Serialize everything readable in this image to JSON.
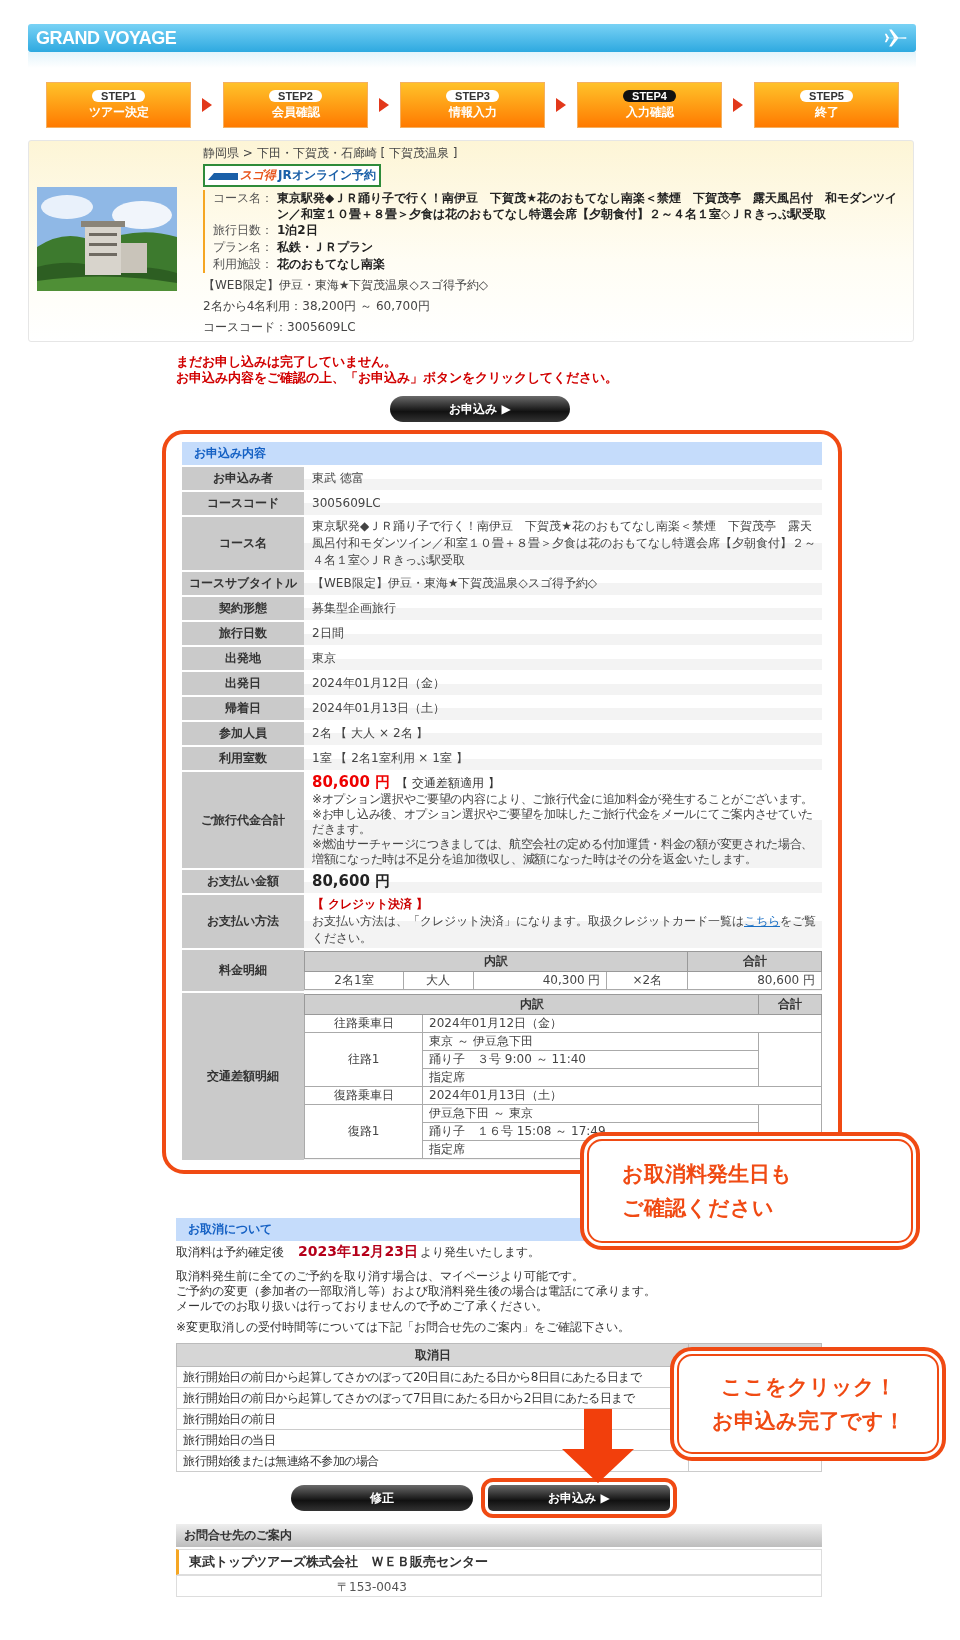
{
  "header": {
    "brand": "GRAND VOYAGE"
  },
  "steps": [
    {
      "badge": "STEP1",
      "label": "ツアー決定",
      "selected": false
    },
    {
      "badge": "STEP2",
      "label": "会員確認",
      "selected": false
    },
    {
      "badge": "STEP3",
      "label": "情報入力",
      "selected": false
    },
    {
      "badge": "STEP4",
      "label": "入力確認",
      "selected": true
    },
    {
      "badge": "STEP5",
      "label": "終了",
      "selected": false
    }
  ],
  "course": {
    "breadcrumb": "静岡県 > 下田・下賀茂・石廊崎 [ 下賀茂温泉 ]",
    "badge": {
      "brand": "スゴ得",
      "label": "JRオンライン予約"
    },
    "details": [
      {
        "label": "コース名：",
        "value": "東京駅発◆ＪＲ踊り子で行く！南伊豆　下賀茂★花のおもてなし南楽＜禁煙　下賀茂亭　露天風呂付　和モダンツイン／和室１０畳＋８畳＞夕食は花のおもてなし特選会席【夕朝食付】２～４名１室◇ＪＲきっぷ駅受取"
      },
      {
        "label": "旅行日数：",
        "value": "1泊2日"
      },
      {
        "label": "プラン名：",
        "value": "私鉄・ＪＲプラン"
      },
      {
        "label": "利用施設：",
        "value": "花のおもてなし南楽"
      }
    ],
    "subtitle": "【WEB限定】伊豆・東海★下賀茂温泉◇スゴ得予約◇",
    "price_range": "2名から4名利用：38,200円 ～ 60,700円",
    "code": "コースコード：3005609LC"
  },
  "notice": [
    "まだお申し込みは完了していません。",
    "お申込み内容をご確認の上、「お申込み」ボタンをクリックしてください。"
  ],
  "top_button": "お申込み ▶",
  "form": {
    "title": "お申込み内容",
    "rows": [
      {
        "kind": "text",
        "label": "お申込み者",
        "value": "東武 徳富"
      },
      {
        "kind": "text",
        "label": "コースコード",
        "value": "3005609LC"
      },
      {
        "kind": "text",
        "label": "コース名",
        "value": "東京駅発◆ＪＲ踊り子で行く！南伊豆　下賀茂★花のおもてなし南楽＜禁煙　下賀茂亭　露天風呂付和モダンツイン／和室１０畳＋８畳＞夕食は花のおもてなし特選会席【夕朝食付】２～４名１室◇ＪＲきっぷ駅受取"
      },
      {
        "kind": "text",
        "label": "コースサブタイトル",
        "value": "【WEB限定】伊豆・東海★下賀茂温泉◇スゴ得予約◇"
      },
      {
        "kind": "text",
        "label": "契約形態",
        "value": "募集型企画旅行"
      },
      {
        "kind": "text",
        "label": "旅行日数",
        "value": "2日間"
      },
      {
        "kind": "text",
        "label": "出発地",
        "value": "東京"
      },
      {
        "kind": "text",
        "label": "出発日",
        "value": "2024年01月12日（金）"
      },
      {
        "kind": "text",
        "label": "帰着日",
        "value": "2024年01月13日（土）"
      },
      {
        "kind": "text",
        "label": "参加人員",
        "value": "2名 【 大人 × 2名 】"
      },
      {
        "kind": "text",
        "label": "利用室数",
        "value": "1室 【 2名1室利用 × 1室 】"
      },
      {
        "kind": "price",
        "label": "ご旅行代金合計",
        "amount": "80,600 円",
        "note": "【 交通差額適用 】",
        "lines": [
          "※オプション選択やご要望の内容により、ご旅行代金に追加料金が発生することがございます。",
          "※お申し込み後、オプション選択やご要望を加味したご旅行代金をメールにてご案内させていただきます。",
          "※燃油サーチャージにつきましては、航空会社の定める付加運賃・料金の額が変更された場合、増額になった時は不足分を追加徴収し、減額になった時はその分を返金いたします。"
        ]
      },
      {
        "kind": "amount",
        "label": "お支払い金額",
        "amount": "80,600 円"
      },
      {
        "kind": "payment",
        "label": "お支払い方法",
        "method": "【 クレジット決済 】",
        "text_before": "お支払い方法は、「クレジット決済」になります。取扱クレジットカード一覧は",
        "link": "こちら",
        "text_after": "をご覧ください。"
      },
      {
        "kind": "fees",
        "label": "料金明細",
        "columns": [
          "内訳",
          "合計"
        ],
        "cells": [
          "2名1室",
          "大人",
          "40,300 円",
          "×2名",
          "80,600 円"
        ]
      },
      {
        "kind": "transport",
        "label": "交通差額明細",
        "columns": [
          "内訳",
          "合計"
        ],
        "legs": [
          {
            "date_label": "往路乗車日",
            "date": "2024年01月12日（金）",
            "name": "往路1",
            "lines": [
              "東京 ～ 伊豆急下田",
              "踊り子　３号 9:00 ～ 11:40",
              "指定席"
            ]
          },
          {
            "date_label": "復路乗車日",
            "date": "2024年01月13日（土）",
            "name": "復路1",
            "lines": [
              "伊豆急下田 ～ 東京",
              "踊り子　１６号 15:08 ～ 17:49",
              "指定席"
            ]
          }
        ]
      }
    ]
  },
  "callouts": [
    {
      "lines": [
        "お取消料発生日も",
        "ご確認ください"
      ]
    },
    {
      "lines": [
        "ここをクリック！",
        "お申込み完了です！"
      ]
    }
  ],
  "cancel": {
    "title": "お取消について",
    "lead": "取消料は予約確定後　**2023年12月23日**より発生いたします。",
    "paragraphs": [
      "取消料発生前に全てのご予約を取り消す場合は、マイページより可能です。",
      "ご予約の変更（参加者の一部取消し等）および取消料発生後の場合は電話にて承ります。",
      "メールでのお取り扱いは行っておりませんので予めご了承ください。"
    ],
    "note": "※変更取消しの受付時間等については下記「お問合せ先のご案内」をご確認下さい。",
    "table": {
      "column": "取消日",
      "rows": [
        "旅行開始日の前日から起算してさかのぼって20日目にあたる日から8日目にあたる日まで",
        "旅行開始日の前日から起算してさかのぼって7日目にあたる日から2日目にあたる日まで",
        "旅行開始日の前日",
        "旅行開始日の当日",
        "旅行開始後または無連絡不参加の場合"
      ]
    }
  },
  "buttons": [
    {
      "label": "修正",
      "highlighted": false
    },
    {
      "label": "お申込み ▶",
      "highlighted": true
    }
  ],
  "contact": {
    "title": "お問合せ先のご案内",
    "company": "東武トップツアーズ株式会社　ＷＥＢ販売センター",
    "address": "〒153-0043"
  }
}
